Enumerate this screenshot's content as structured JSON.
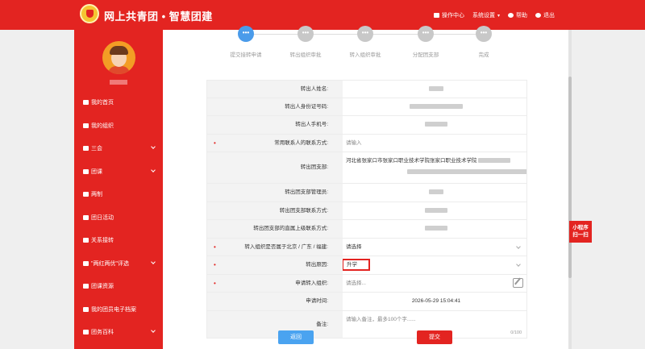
{
  "header": {
    "brand": "网上共青团 • 智慧团建",
    "nav": [
      {
        "label": "操作中心",
        "icon": "envelope-icon"
      },
      {
        "label": "系统设置",
        "icon": "gear-icon"
      },
      {
        "label": "帮助",
        "icon": "help-icon"
      },
      {
        "label": "退出",
        "icon": "power-icon"
      }
    ]
  },
  "sidebar": {
    "items": [
      {
        "label": "我的首页",
        "icon": "home-icon",
        "expandable": false
      },
      {
        "label": "我的组织",
        "icon": "group-icon",
        "expandable": false
      },
      {
        "label": "三会",
        "icon": "checkbox-icon",
        "expandable": true
      },
      {
        "label": "团课",
        "icon": "folder-icon",
        "expandable": true
      },
      {
        "label": "两制",
        "icon": "target-icon",
        "expandable": false
      },
      {
        "label": "团日活动",
        "icon": "recycle-icon",
        "expandable": false
      },
      {
        "label": "关系接转",
        "icon": "transfer-icon",
        "expandable": false
      },
      {
        "label": "\"两红两优\"评选",
        "icon": "checkbox-icon",
        "expandable": true
      },
      {
        "label": "团课资源",
        "icon": "folder-icon",
        "expandable": false
      },
      {
        "label": "我的团员电子档案",
        "icon": "document-icon",
        "expandable": false
      },
      {
        "label": "团务百科",
        "icon": "group-icon",
        "expandable": true
      }
    ]
  },
  "steps": [
    {
      "label": "提交接转申请",
      "active": true,
      "glyph": "•••"
    },
    {
      "label": "转出组织审批",
      "active": false,
      "glyph": "•••"
    },
    {
      "label": "转入组织审批",
      "active": false,
      "glyph": "•••"
    },
    {
      "label": "分配团支部",
      "active": false,
      "glyph": "•••"
    },
    {
      "label": "完成",
      "active": false,
      "glyph": "•••"
    }
  ],
  "form": {
    "name_label": "转出人姓名:",
    "id_label": "转出人身份证号码:",
    "phone_label": "转出人手机号:",
    "contact_label": "常用联系人的联系方式:",
    "contact_placeholder": "请输入",
    "branch_label": "转出团支部:",
    "branch_value": "河北省张家口市张家口职业技术学院张家口职业技术学院",
    "manager_label": "转出团支部管理员:",
    "branch_contact_label": "转出团支部联系方式:",
    "superior_contact_label": "转出团支部的直属上级联系方式:",
    "region_label": "转入组织是否属于北京 / 广东 / 福建:",
    "region_placeholder": "请选择",
    "reason_label": "转出原因:",
    "reason_value": "升学",
    "target_label": "申请转入组织:",
    "target_placeholder": "请选择...",
    "time_label": "申请时间:",
    "time_value": "2026-05-29 15:04:41",
    "remark_label": "备注:",
    "remark_placeholder": "请输入备注，最多100个字......",
    "remark_counter": "0/100"
  },
  "buttons": {
    "back": "返回",
    "submit": "提交"
  },
  "mini_program": {
    "line1": "小程序",
    "line2": "扫一扫"
  },
  "colors": {
    "brand_red": "#e32421",
    "active_step": "#4a9bea",
    "back_button": "#4aa3f0"
  }
}
